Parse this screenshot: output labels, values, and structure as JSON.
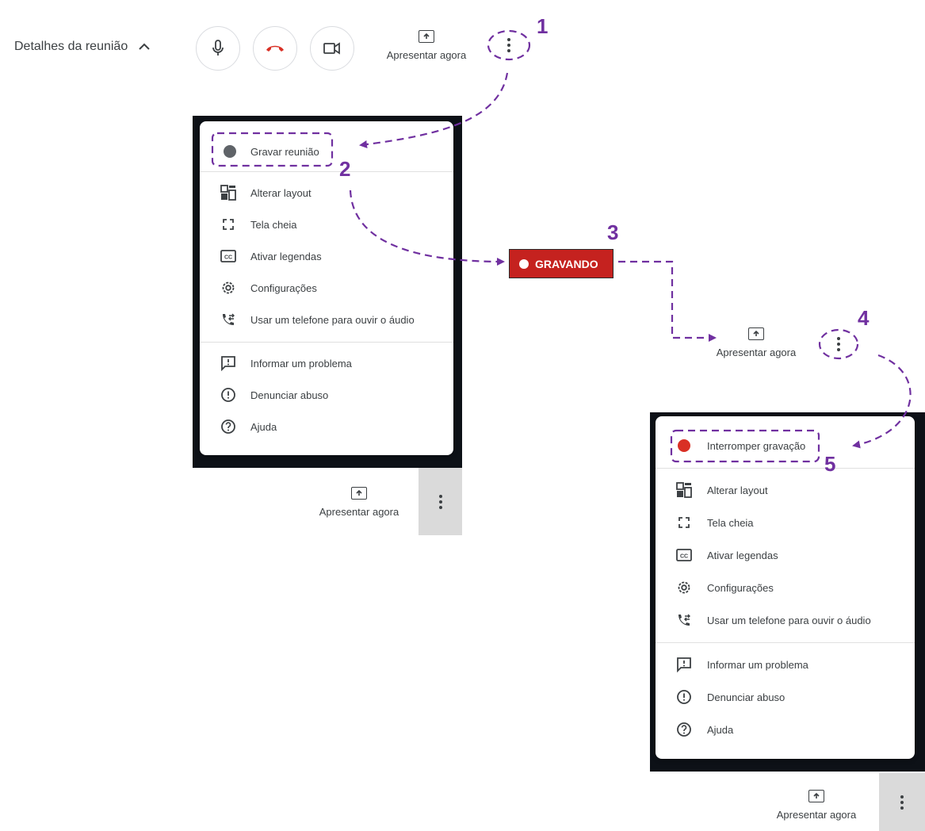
{
  "topbar": {
    "meeting_details": "Detalhes da reunião",
    "present_label": "Apresentar agora"
  },
  "menu1": {
    "items": [
      {
        "label": "Gravar reunião",
        "icon": "record-dot-icon"
      },
      {
        "label": "Alterar layout",
        "icon": "layout-icon"
      },
      {
        "label": "Tela cheia",
        "icon": "fullscreen-icon"
      },
      {
        "label": "Ativar legendas",
        "icon": "captions-icon"
      },
      {
        "label": "Configurações",
        "icon": "settings-icon"
      },
      {
        "label": "Usar um telefone para ouvir o áudio",
        "icon": "phone-forward-icon"
      },
      {
        "label": "Informar um problema",
        "icon": "feedback-icon"
      },
      {
        "label": "Denunciar abuso",
        "icon": "report-icon"
      },
      {
        "label": "Ajuda",
        "icon": "help-icon"
      }
    ],
    "present_label": "Apresentar agora"
  },
  "recording_badge": "GRAVANDO",
  "mid_present_label": "Apresentar agora",
  "menu2": {
    "items": [
      {
        "label": "Interromper gravação",
        "icon": "stop-record-dot-icon"
      },
      {
        "label": "Alterar layout",
        "icon": "layout-icon"
      },
      {
        "label": "Tela cheia",
        "icon": "fullscreen-icon"
      },
      {
        "label": "Ativar legendas",
        "icon": "captions-icon"
      },
      {
        "label": "Configurações",
        "icon": "settings-icon"
      },
      {
        "label": "Usar um telefone para ouvir o áudio",
        "icon": "phone-forward-icon"
      },
      {
        "label": "Informar um problema",
        "icon": "feedback-icon"
      },
      {
        "label": "Denunciar abuso",
        "icon": "report-icon"
      },
      {
        "label": "Ajuda",
        "icon": "help-icon"
      }
    ],
    "present_label": "Apresentar agora"
  },
  "steps": [
    "1",
    "2",
    "3",
    "4",
    "5"
  ],
  "colors": {
    "annotation": "#7030a0",
    "recording_red": "#c5221f",
    "record_dot_grey": "#5f6368",
    "stop_dot_red": "#d93025",
    "hangup_red": "#d93025"
  }
}
